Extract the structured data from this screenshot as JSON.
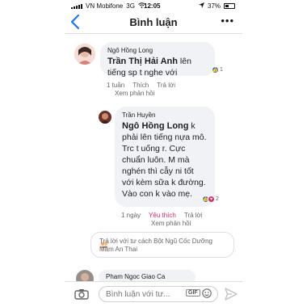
{
  "status_bar": {
    "carrier": "VN Mobifone",
    "network": "3G",
    "time": "12:05",
    "battery": "37%",
    "battery_level": 0.37
  },
  "nav": {
    "title": "Bình luận",
    "more": "•••"
  },
  "comments": [
    {
      "author": "Ngô Hồng Long",
      "mention": "Trần Thị Hải Anh",
      "text": " lên tiếng sp t nghe với",
      "reaction_count": "1",
      "time": "1 tuần",
      "like": "Thích",
      "reply": "Trả lời",
      "view_replies": "Xem phản hồi"
    },
    {
      "author": "Trần Huyền",
      "mention": "Ngô Hồng Long",
      "text": " k phải lên tiếng nựa mô. Trc t uống r. Cực chuẩn luôn. M mà nghén thì cẫy ni tốt với kèm sữa k đường. Vào con k vào mẹ.",
      "reaction_count": "2",
      "time": "1 ngày",
      "like": "Yêu thích",
      "reply": "Trả lời",
      "view_replies": "Xem phản hồi"
    }
  ],
  "reply_box": {
    "placeholder": "Trả lời với tư cách Bột Ngũ Cốc Dưỡng Mầm An Thai"
  },
  "next_comment": {
    "author": "Pham Ngoc Giao Ca"
  },
  "composer": {
    "placeholder": "Bình luận với tư...",
    "gif": "GIF"
  },
  "colors": {
    "like_blue": "#1877f2",
    "love_red": "#e0245e",
    "nav_blue": "#1877f2"
  }
}
